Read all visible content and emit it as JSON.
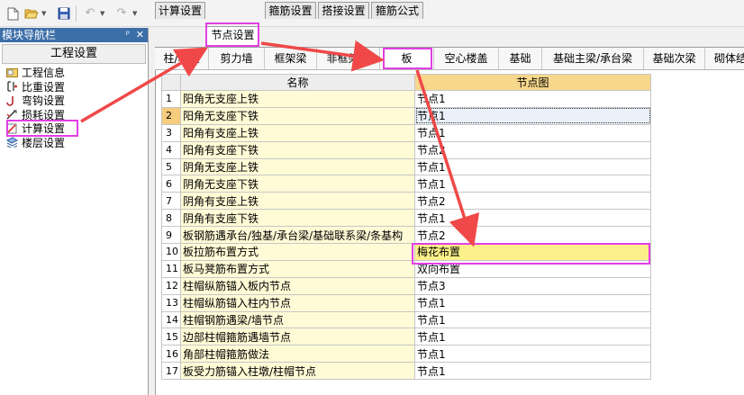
{
  "toolbar": {
    "icons": [
      "new-file-icon",
      "open-folder-icon",
      "save-icon",
      "undo-icon",
      "redo-icon"
    ]
  },
  "left_panel": {
    "title": "模块导航栏",
    "pin": "ᵖ",
    "close": "✕",
    "subtitle": "工程设置",
    "items": [
      {
        "label": "工程信息",
        "icon": "info-icon"
      },
      {
        "label": "比重设置",
        "icon": "weight-icon"
      },
      {
        "label": "弯钩设置",
        "icon": "hook-icon"
      },
      {
        "label": "损耗设置",
        "icon": "loss-icon"
      },
      {
        "label": "计算设置",
        "icon": "calc-icon"
      },
      {
        "label": "楼层设置",
        "icon": "floor-icon"
      }
    ]
  },
  "tabs": [
    {
      "label": "计算设置"
    },
    {
      "label": "节点设置"
    },
    {
      "label": "箍筋设置"
    },
    {
      "label": "搭接设置"
    },
    {
      "label": "箍筋公式"
    }
  ],
  "subtabs": [
    {
      "label": "柱/墙柱"
    },
    {
      "label": "剪力墙"
    },
    {
      "label": "框架梁"
    },
    {
      "label": "非框架梁"
    },
    {
      "label": "板"
    },
    {
      "label": "空心楼盖"
    },
    {
      "label": "基础"
    },
    {
      "label": "基础主梁/承台梁"
    },
    {
      "label": "基础次梁"
    },
    {
      "label": "砌体结"
    }
  ],
  "grid": {
    "header": {
      "name": "名称",
      "value": "节点图"
    },
    "rows": [
      {
        "n": "1",
        "name": "阳角无支座上铁",
        "value": "节点1"
      },
      {
        "n": "2",
        "name": "阳角无支座下铁",
        "value": "节点1"
      },
      {
        "n": "3",
        "name": "阳角有支座上铁",
        "value": "节点1"
      },
      {
        "n": "4",
        "name": "阳角有支座下铁",
        "value": "节点2"
      },
      {
        "n": "5",
        "name": "阴角无支座上铁",
        "value": "节点1"
      },
      {
        "n": "6",
        "name": "阴角无支座下铁",
        "value": "节点1"
      },
      {
        "n": "7",
        "name": "阴角有支座上铁",
        "value": "节点2"
      },
      {
        "n": "8",
        "name": "阴角有支座下铁",
        "value": "节点1"
      },
      {
        "n": "9",
        "name": "板钢筋遇承台/独基/承台梁/基础联系梁/条基构",
        "value": "节点2"
      },
      {
        "n": "10",
        "name": "板拉筋布置方式",
        "value": "梅花布置"
      },
      {
        "n": "11",
        "name": "板马凳筋布置方式",
        "value": "双向布置"
      },
      {
        "n": "12",
        "name": "柱帽纵筋锚入板内节点",
        "value": "节点3"
      },
      {
        "n": "13",
        "name": "柱帽纵筋锚入柱内节点",
        "value": "节点1"
      },
      {
        "n": "14",
        "name": "柱帽钢筋遇梁/墙节点",
        "value": "节点1"
      },
      {
        "n": "15",
        "name": "边部柱帽箍筋遇墙节点",
        "value": "节点1"
      },
      {
        "n": "16",
        "name": "角部柱帽箍筋做法",
        "value": "节点1"
      },
      {
        "n": "17",
        "name": "板受力筋锚入柱墩/柱帽节点",
        "value": "节点1"
      }
    ]
  },
  "colors": {
    "annotation": "#e33fe3",
    "arrow": "#f04848",
    "panel_title_bg": "#3c6ea8",
    "name_cell_bg": "#fffbd6",
    "header_value_bg": "#f7d78c",
    "highlight_cell_bg": "#fcf08a"
  }
}
